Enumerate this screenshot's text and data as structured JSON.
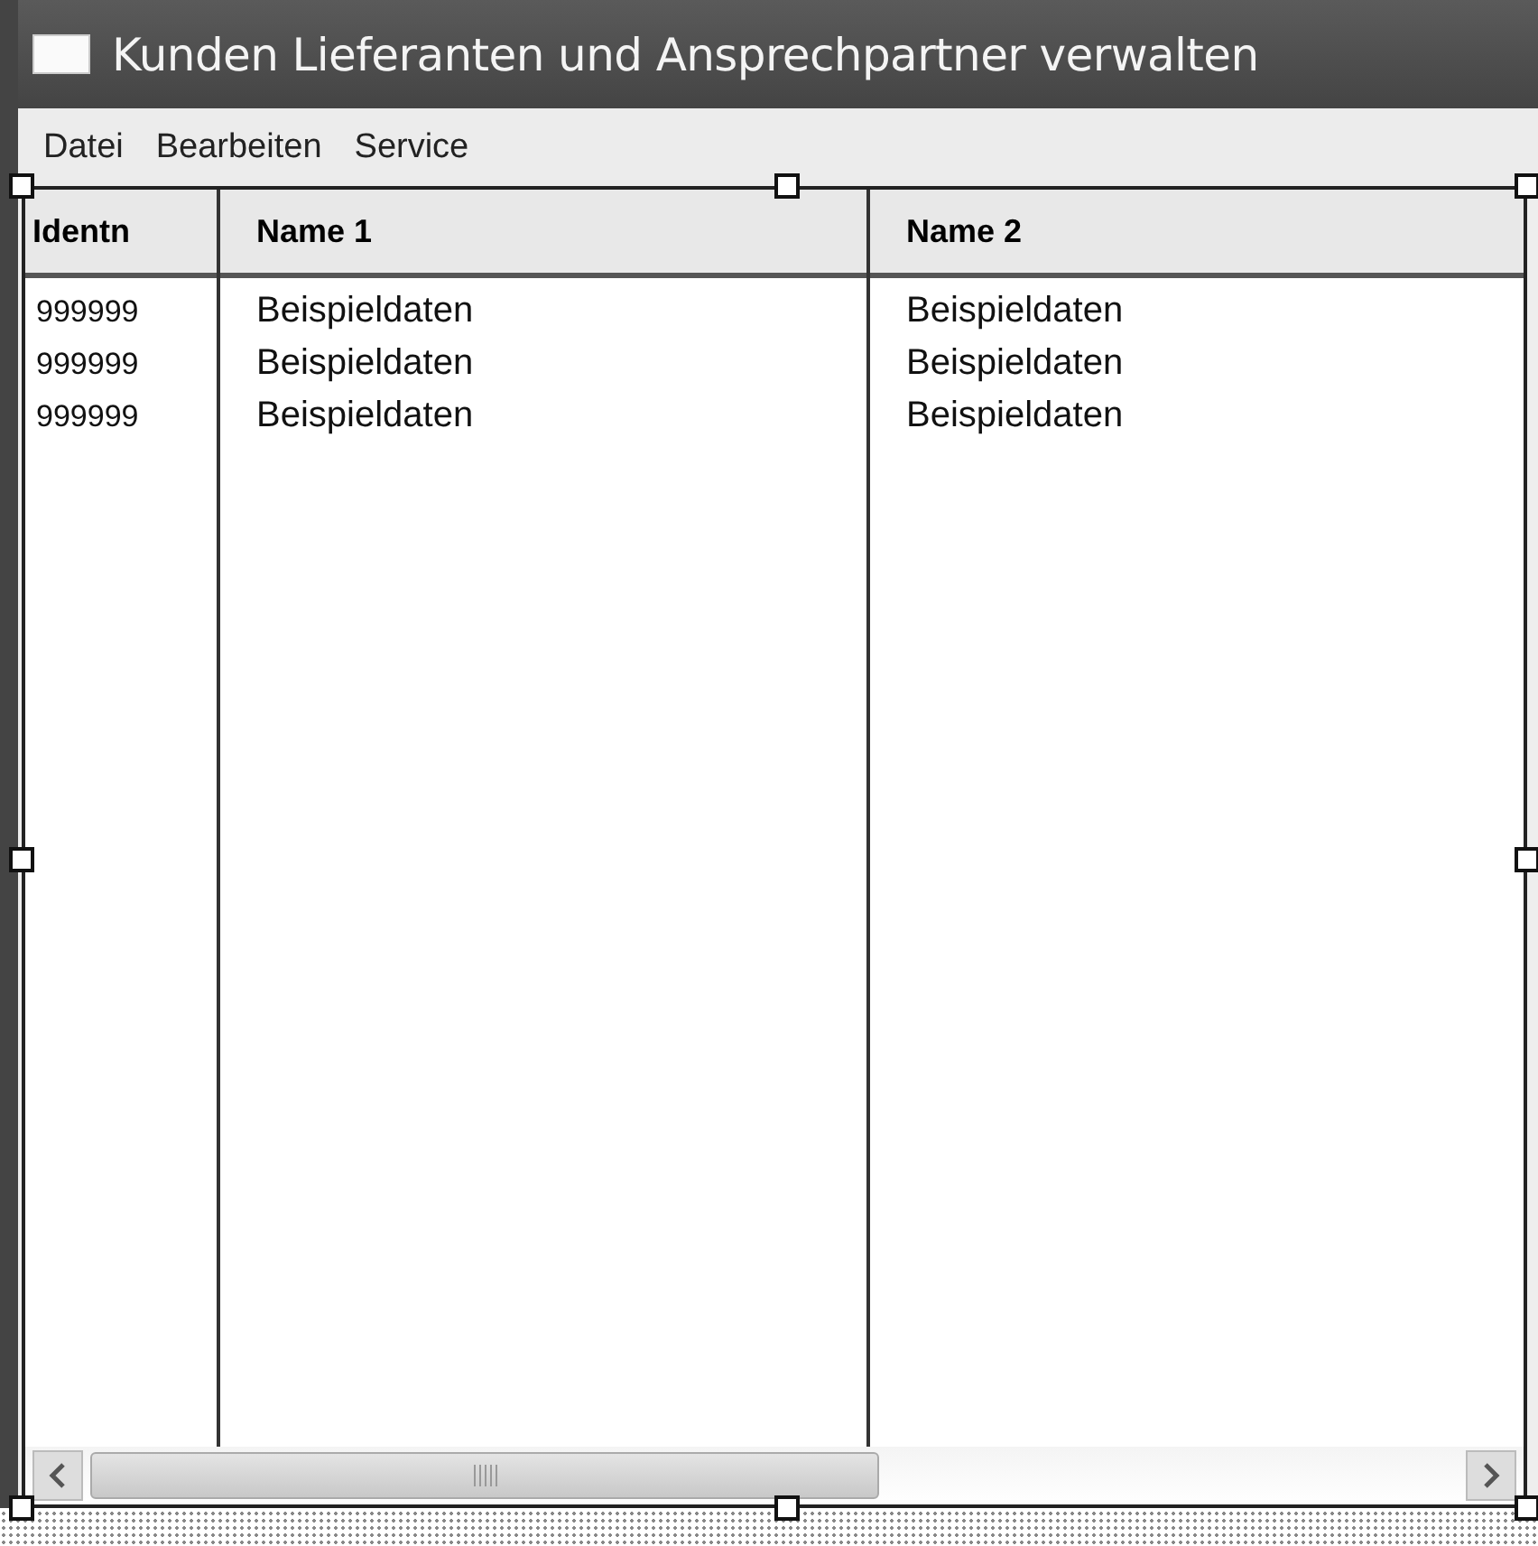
{
  "window": {
    "title": "Kunden Lieferanten und Ansprechpartner verwalten"
  },
  "menu": [
    {
      "label": "Datei"
    },
    {
      "label": "Bearbeiten"
    },
    {
      "label": "Service"
    }
  ],
  "table": {
    "columns": [
      "Identn",
      "Name 1",
      "Name 2"
    ],
    "rows": [
      [
        "999999",
        "Beispieldaten",
        "Beispieldaten"
      ],
      [
        "999999",
        "Beispieldaten",
        "Beispieldaten"
      ],
      [
        "999999",
        "Beispieldaten",
        "Beispieldaten"
      ]
    ]
  }
}
